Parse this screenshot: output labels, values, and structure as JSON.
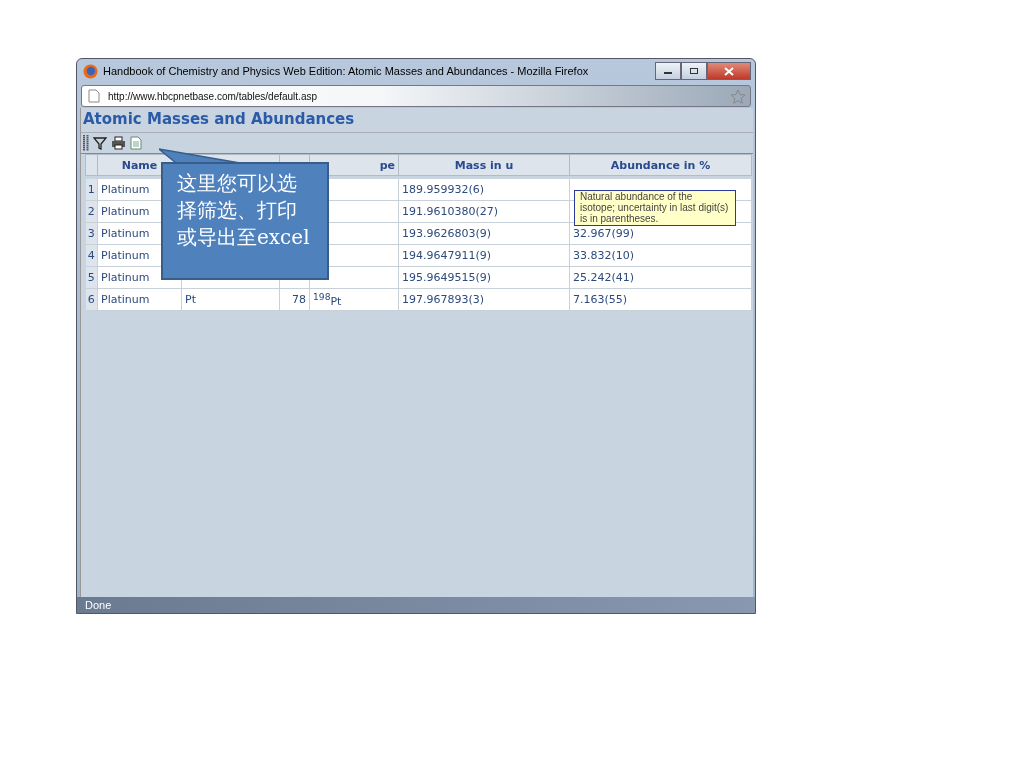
{
  "window": {
    "title": "Handbook of Chemistry and Physics Web Edition: Atomic Masses and Abundances - Mozilla Firefox"
  },
  "address_bar": {
    "url": "http://www.hbcpnetbase.com/tables/default.asp"
  },
  "page": {
    "heading": "Atomic Masses and Abundances"
  },
  "table": {
    "columns": [
      "Name",
      null,
      null,
      "pe",
      "Mass in u",
      "Abundance in %"
    ],
    "rows": [
      {
        "index": "1",
        "cells": [
          "Platinum",
          null,
          null,
          null,
          "189.959932(6)",
          null
        ]
      },
      {
        "index": "2",
        "cells": [
          "Platinum",
          null,
          null,
          null,
          "191.9610380(27)",
          null
        ]
      },
      {
        "index": "3",
        "cells": [
          "Platinum",
          null,
          null,
          null,
          "193.9626803(9)",
          "32.967(99)"
        ]
      },
      {
        "index": "4",
        "cells": [
          "Platinum",
          null,
          null,
          null,
          "194.9647911(9)",
          "33.832(10)"
        ]
      },
      {
        "index": "5",
        "cells": [
          "Platinum",
          null,
          null,
          null,
          "195.9649515(9)",
          "25.242(41)"
        ]
      },
      {
        "index": "6",
        "cells": [
          "Platinum",
          "Pt",
          "78",
          "$^{198}$Pt",
          "197.967893(3)",
          "7.163(55)"
        ]
      }
    ]
  },
  "tooltip": {
    "text": "Natural abundance of the isotope; uncertainty in last digit(s) is in parentheses."
  },
  "callout": {
    "text": "这里您可以选择筛选、打印或导出至excel"
  },
  "status_bar": {
    "text": "Done"
  }
}
